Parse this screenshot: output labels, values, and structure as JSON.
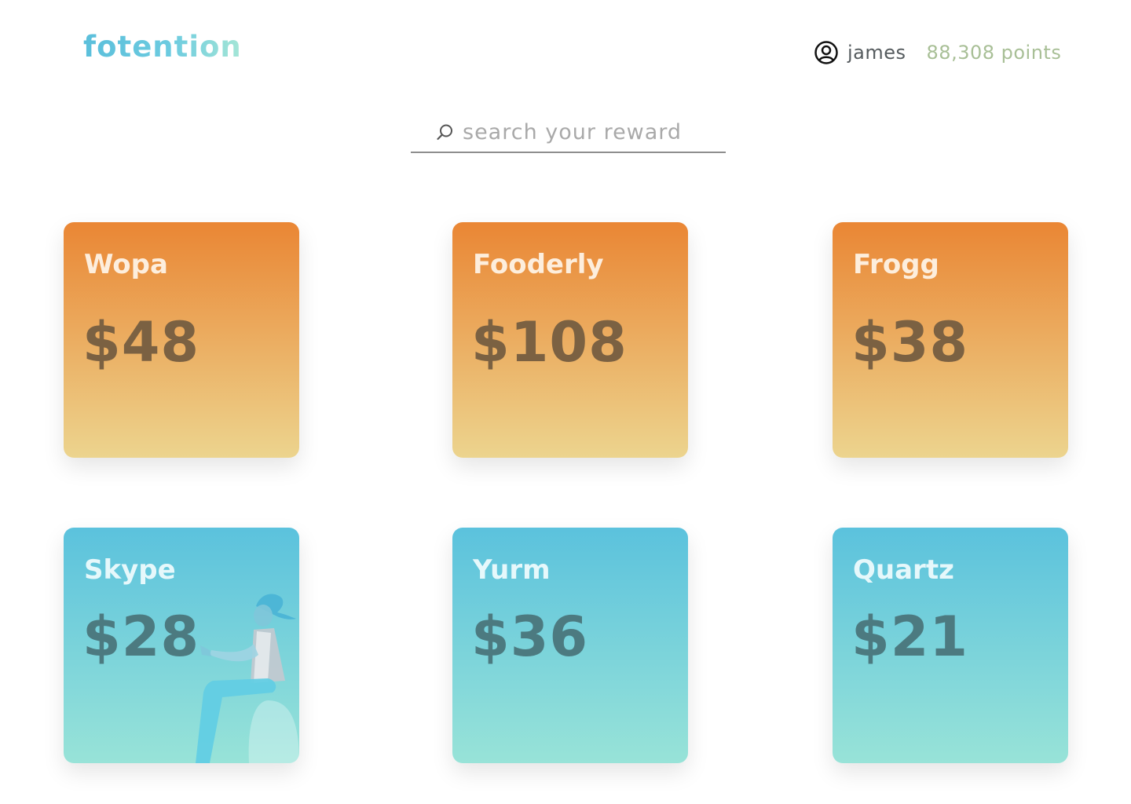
{
  "header": {
    "logo": "fotention",
    "user_icon": "user-circle-icon",
    "username": "james",
    "points": "88,308 points"
  },
  "search": {
    "icon": "search-icon",
    "placeholder": "search your reward",
    "value": ""
  },
  "rewards": [
    {
      "name": "Wopa",
      "price": "$48",
      "theme": "orange"
    },
    {
      "name": "Fooderly",
      "price": "$108",
      "theme": "orange"
    },
    {
      "name": "Frogg",
      "price": "$38",
      "theme": "orange"
    },
    {
      "name": "Skype",
      "price": "$28",
      "theme": "blue"
    },
    {
      "name": "Yurm",
      "price": "$36",
      "theme": "blue"
    },
    {
      "name": "Quartz",
      "price": "$21",
      "theme": "blue"
    }
  ],
  "colors": {
    "logo": "#5bbfdb",
    "points": "#a8bf96",
    "orange_top": "#ea8634",
    "orange_bottom": "#ecd48e",
    "blue_top": "#5bc2dd",
    "blue_bottom": "#98e3d8"
  }
}
